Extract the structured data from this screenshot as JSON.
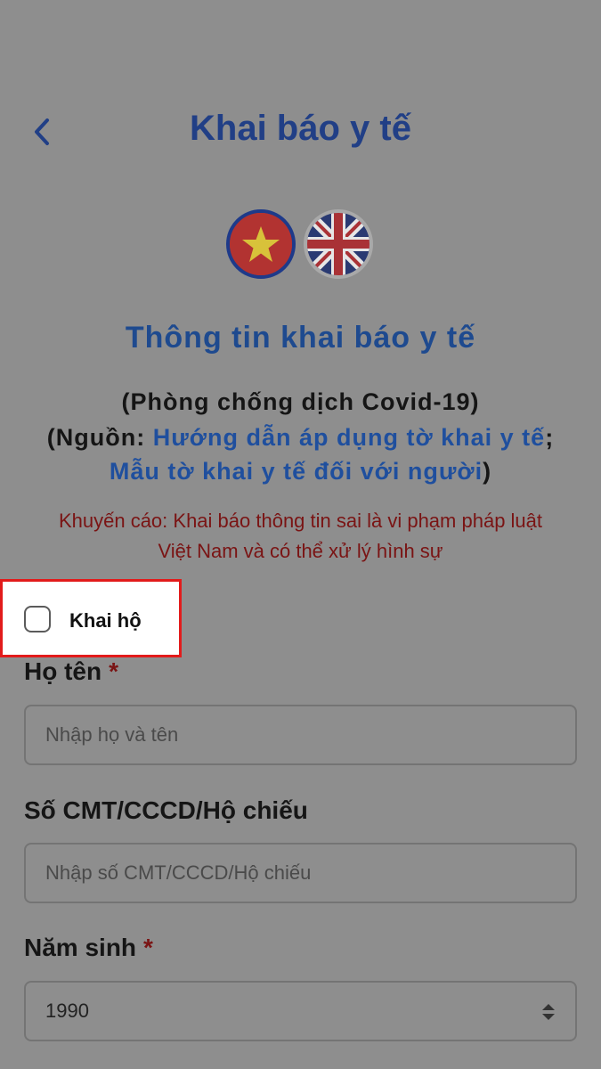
{
  "header": {
    "title": "Khai báo y tế",
    "back_icon": "chevron-left-icon"
  },
  "languages": [
    {
      "name": "vietnam-flag-icon",
      "selected": true
    },
    {
      "name": "uk-flag-icon",
      "selected": false
    }
  ],
  "info": {
    "section_title": "Thông tin khai báo y tế",
    "subtitle": "(Phòng chống dịch Covid-19)",
    "source_prefix": "(Nguồn: ",
    "source_link_1": "Hướng dẫn áp dụng tờ khai y tế",
    "source_separator": ";",
    "source_link_2": "Mẫu tờ khai y tế đối với người",
    "source_suffix": ")",
    "warning_line_1": "Khuyến cáo: Khai báo thông tin sai là vi phạm pháp luật",
    "warning_line_2": "Việt Nam và có thể xử lý hình sự"
  },
  "khai_ho": {
    "label": "Khai hộ",
    "checked": false
  },
  "form": {
    "name": {
      "label": "Họ tên",
      "required_mark": "*",
      "placeholder": "Nhập họ và tên"
    },
    "id_number": {
      "label": "Số CMT/CCCD/Hộ chiếu",
      "placeholder": "Nhập số CMT/CCCD/Hộ chiếu"
    },
    "birth_year": {
      "label": "Năm sinh",
      "required_mark": "*",
      "value": "1990"
    }
  },
  "colors": {
    "overlay": "#8e8e8e",
    "title_blue": "#213f86",
    "link_blue": "#1f4f9e",
    "warning_red": "#7a1414",
    "highlight_red": "#e21b1b"
  }
}
